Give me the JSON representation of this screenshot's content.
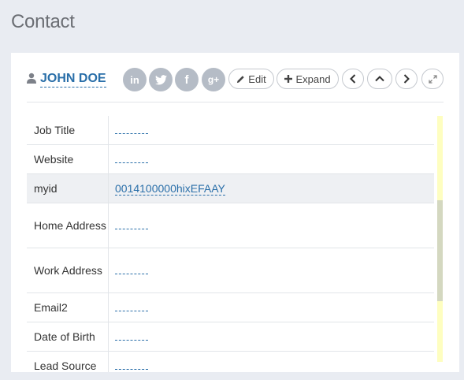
{
  "page": {
    "title": "Contact"
  },
  "header": {
    "name": "JOHN DOE",
    "social": [
      {
        "name": "linkedin-icon",
        "glyph": "in"
      },
      {
        "name": "twitter-icon",
        "glyph": ""
      },
      {
        "name": "facebook-icon",
        "glyph": "f"
      },
      {
        "name": "google-plus-icon",
        "glyph": "g+"
      }
    ],
    "edit_label": "Edit",
    "expand_label": "Expand"
  },
  "rows": [
    {
      "label": "Job Title",
      "value": ""
    },
    {
      "label": "Website",
      "value": ""
    },
    {
      "label": "myid",
      "value": "0014100000hixEFAAY"
    },
    {
      "label": "Home Address",
      "value": ""
    },
    {
      "label": "Work Address",
      "value": ""
    },
    {
      "label": "Email2",
      "value": ""
    },
    {
      "label": "Date of Birth",
      "value": ""
    },
    {
      "label": "Lead Source",
      "value": ""
    }
  ],
  "colors": {
    "link": "#2a6fa9",
    "social": "#b5bcc6",
    "scrollbar": "#fefec0"
  }
}
